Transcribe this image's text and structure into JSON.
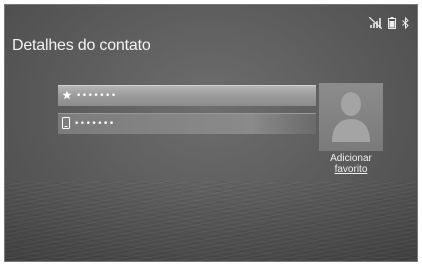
{
  "header": {
    "title": "Detalhes do contato"
  },
  "status_icons": [
    "no-signal-icon",
    "battery-icon",
    "bluetooth-icon"
  ],
  "fields": [
    {
      "icon": "star-icon",
      "value": "•••••••"
    },
    {
      "icon": "phone-icon",
      "value": "•••••••"
    }
  ],
  "favorite": {
    "icon": "person-silhouette-icon",
    "label_line1": "Adicionar",
    "label_line2": "favorito"
  },
  "colors": {
    "background": "#5f5f5f",
    "text": "#f2f2f2"
  }
}
